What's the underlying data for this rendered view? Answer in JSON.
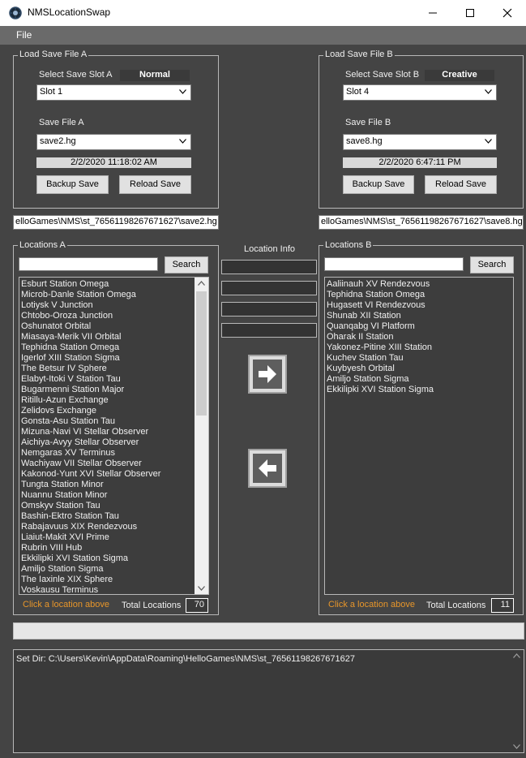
{
  "window": {
    "title": "NMSLocationSwap",
    "icons": {
      "app": "nms-app-icon",
      "minimize": "minimize-icon",
      "maximize": "maximize-icon",
      "close": "close-icon"
    }
  },
  "menu": {
    "file": "File"
  },
  "save_a": {
    "group_title": "Load Save File A",
    "slot_label": "Select Save Slot A",
    "mode": "Normal",
    "slot_value": "Slot 1",
    "file_label": "Save File A",
    "file_value": "save2.hg",
    "date": "2/2/2020 11:18:02 AM",
    "backup_label": "Backup Save",
    "reload_label": "Reload Save",
    "path": "elloGames\\NMS\\st_76561198267671627\\save2.hg"
  },
  "save_b": {
    "group_title": "Load Save File B",
    "slot_label": "Select Save Slot B",
    "mode": "Creative",
    "slot_value": "Slot 4",
    "file_label": "Save File B",
    "file_value": "save8.hg",
    "date": "2/2/2020 6:47:11 PM",
    "backup_label": "Backup Save",
    "reload_label": "Reload Save",
    "path": "elloGames\\NMS\\st_76561198267671627\\save8.hg"
  },
  "locations_a": {
    "group_title": "Locations A",
    "search_label": "Search",
    "hint": "Click a location above",
    "total_label": "Total Locations",
    "total": "70",
    "items": [
      "Esburt Station Omega",
      "Microb-Danle Station Omega",
      "Lotiysk V Junction",
      "Chtobo-Oroza Junction",
      "Oshunatot Orbital",
      "Miasaya-Merik VII Orbital",
      "Tephidna Station Omega",
      "Igerlof XIII Station Sigma",
      "The Betsur IV Sphere",
      "Elabyt-Itoki V Station Tau",
      "Bugarmenni Station Major",
      "Ritillu-Azun Exchange",
      "Zelidovs Exchange",
      "Gonsta-Asu Station Tau",
      "Mizuna-Navi VI Stellar Observer",
      "Aichiya-Avyy Stellar Observer",
      "Nemgaras XV Terminus",
      "Wachiyaw VII Stellar Observer",
      "Kakonod-Yunt XVI Stellar Observer",
      "Tungta Station Minor",
      "Nuannu Station Minor",
      "Omskyv Station Tau",
      "Bashin-Ektro Station Tau",
      "Rabajavuus XIX Rendezvous",
      "Liaiut-Makit XVI Prime",
      "Rubrin VIII Hub",
      "Ekkilipki XVI Station Sigma",
      "Amiljo Station Sigma",
      "The Iaxinle XIX Sphere",
      "Voskausu Terminus"
    ],
    "scroll_fraction": 0.43
  },
  "locations_b": {
    "group_title": "Locations B",
    "search_label": "Search",
    "hint": "Click a location above",
    "total_label": "Total Locations",
    "total": "11",
    "items": [
      "Aaliinauh XV Rendezvous",
      "Tephidna Station Omega",
      "Hugasett VI Rendezvous",
      "Shunab XII Station",
      "Quanqabg VI Platform",
      "Oharak II Station",
      "Yakonez-Pitine XIII Station",
      "Kuchev Station Tau",
      "Kuybyesh Orbital",
      "Amiljo Station Sigma",
      "Ekkilipki XVI Station Sigma"
    ]
  },
  "location_info": {
    "label": "Location Info",
    "icons": {
      "to_b": "arrow-right-icon",
      "to_a": "arrow-left-icon"
    }
  },
  "log": {
    "text": "Set Dir: C:\\Users\\Kevin\\AppData\\Roaming\\HelloGames\\NMS\\st_76561198267671627"
  },
  "colors": {
    "background": "#444444",
    "hint": "#e8962a",
    "menubar": "#6a6a6a"
  }
}
